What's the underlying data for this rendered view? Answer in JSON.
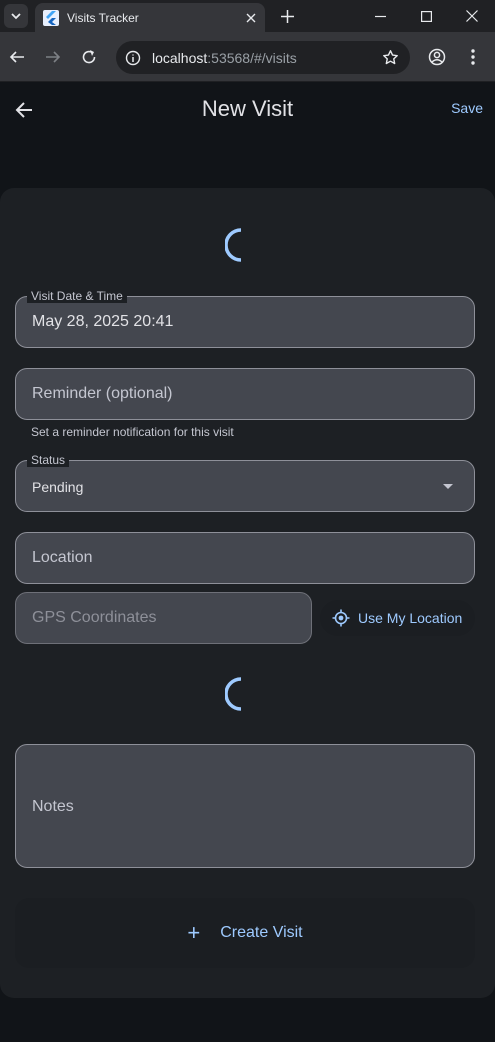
{
  "browser": {
    "tab_title": "Visits Tracker",
    "url_host": "localhost",
    "url_rest": ":53568/#/visits"
  },
  "appbar": {
    "title": "New Visit",
    "save_label": "Save"
  },
  "form": {
    "visit_datetime": {
      "label": "Visit Date & Time",
      "value": "May 28, 2025 20:41"
    },
    "reminder": {
      "placeholder": "Reminder (optional)",
      "helper": "Set a reminder notification for this visit"
    },
    "status": {
      "label": "Status",
      "value": "Pending"
    },
    "location": {
      "placeholder": "Location"
    },
    "gps": {
      "placeholder": "GPS Coordinates"
    },
    "use_location_label": "Use My Location",
    "notes": {
      "placeholder": "Notes"
    },
    "create_label": "Create Visit"
  },
  "colors": {
    "accent": "#9ecaff",
    "background": "#111418",
    "card": "#1d2024",
    "field": "#44474f"
  },
  "icons": {
    "back": "arrow-left-icon",
    "dropdown": "dropdown-arrow-icon",
    "gps": "gps-target-icon",
    "add": "plus-icon"
  }
}
